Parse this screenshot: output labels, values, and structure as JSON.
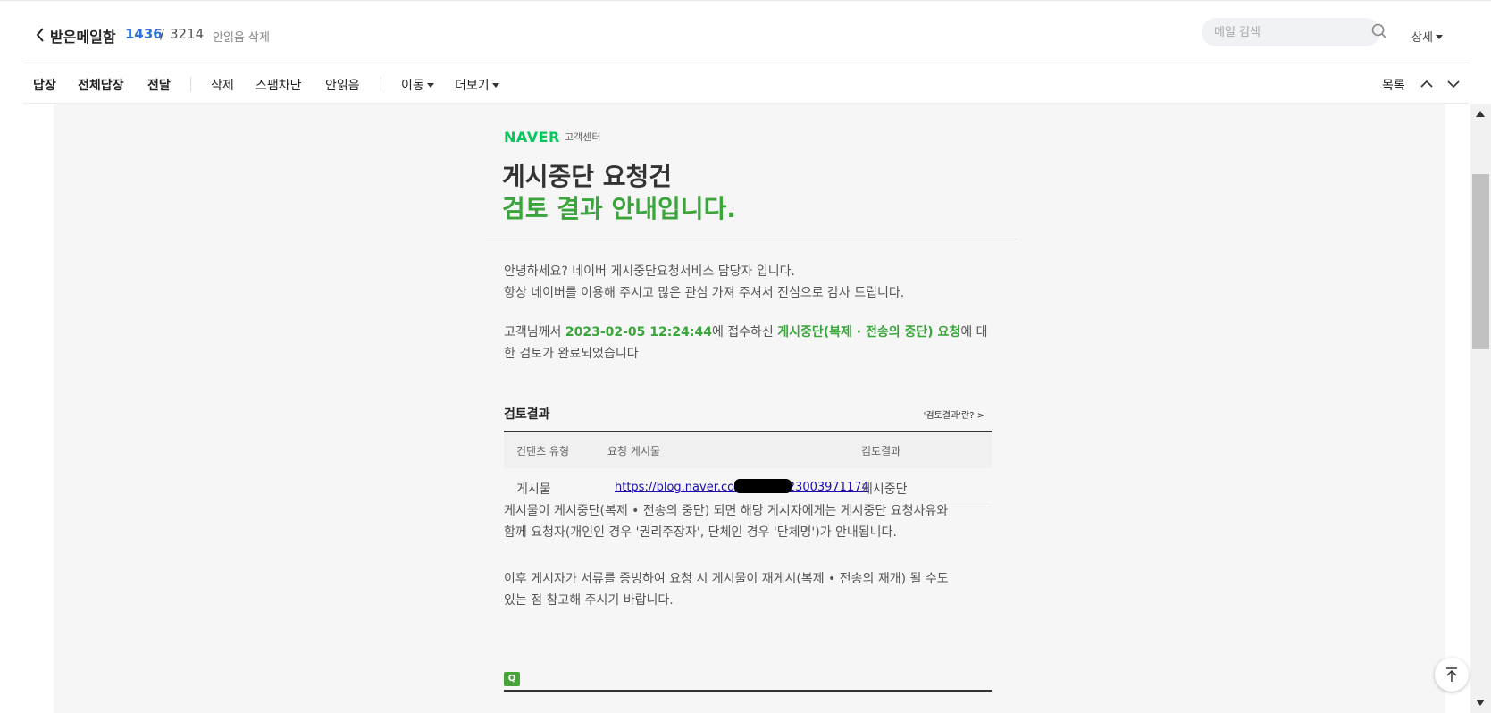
{
  "header": {
    "folder_title": "받은메일함",
    "unread_count": "1436",
    "separator": "/",
    "total_count": "3214",
    "delete_unread": "안읽음 삭제",
    "search_placeholder": "메일 검색",
    "detail_label": "상세"
  },
  "toolbar": {
    "reply": "답장",
    "reply_all": "전체답장",
    "forward": "전달",
    "delete": "삭제",
    "block_spam": "스팸차단",
    "mark_unread": "안읽음",
    "move": "이동",
    "more": "더보기",
    "list": "목록"
  },
  "mail": {
    "logo": "NAVER",
    "logo_sub": "고객센터",
    "headline1": "게시중단 요청건",
    "headline2": "검토 결과 안내입니다.",
    "greeting1": "안녕하세요? 네이버 게시중단요청서비스 담당자 입니다.",
    "greeting2": "항상 네이버를 이용해 주시고 많은 관심 가져 주셔서 진심으로 감사 드립니다.",
    "para_a_prefix": "고객님께서 ",
    "para_a_date": "2023-02-05 12:24:44",
    "para_a_mid": "에 접수하신 ",
    "para_a_request": "게시중단(복제 · 전송의 중단) 요청",
    "para_a_suffix": "에 대",
    "para_a_line2": "한 검토가 완료되었습니다",
    "section_title": "검토결과",
    "section_link": "'검토결과'란? >",
    "table": {
      "headers": [
        "컨텐츠 유형",
        "요청 게시물",
        "검토결과"
      ],
      "row": {
        "type": "게시물",
        "link_prefix": "https://blog.naver.com/",
        "link_suffix": "/223003971174",
        "result": "게시중단"
      }
    },
    "para_b1": "게시물이 게시중단(복제 • 전송의 중단) 되면 해당 게시자에게는 게시중단 요청사유와",
    "para_b2": "함께 요청자(개인인 경우 '권리주장자', 단체인 경우 '단체명')가  안내됩니다.",
    "para_c1": "이후 게시자가 서류를 증빙하여 요청 시 게시물이 재게시(복제 • 전송의 재개) 될 수도",
    "para_c2": "있는 점 참고해 주시기 바랍니다.",
    "q_badge": "Q"
  },
  "colors": {
    "accent_green": "#3aa53a",
    "naver_green": "#03c75a",
    "unread_blue": "#2f6fd8",
    "link_blue": "#1a0dab"
  }
}
